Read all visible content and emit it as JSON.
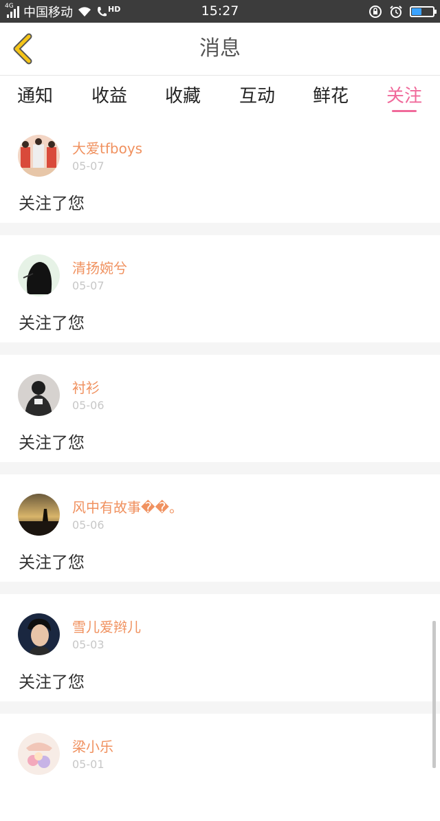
{
  "status_bar": {
    "network": "4G",
    "carrier": "中国移动",
    "hd": "HD",
    "time": "15:27",
    "battery_level": 0.45,
    "battery_color": "#3aa3ff"
  },
  "header": {
    "title": "消息",
    "back_icon": "chevron-left-icon",
    "back_color": "#f5c518"
  },
  "tabs": [
    {
      "label": "通知",
      "active": false
    },
    {
      "label": "收益",
      "active": false
    },
    {
      "label": "收藏",
      "active": false
    },
    {
      "label": "互动",
      "active": false
    },
    {
      "label": "鲜花",
      "active": false
    },
    {
      "label": "关注",
      "active": true
    }
  ],
  "accent_color": "#f0699a",
  "name_color": "#f0915f",
  "messages": [
    {
      "name": "大爱tfboys",
      "date": "05-07",
      "action": "关注了您"
    },
    {
      "name": "清扬婉兮",
      "date": "05-07",
      "action": "关注了您"
    },
    {
      "name": "衬衫",
      "date": "05-06",
      "action": "关注了您"
    },
    {
      "name": "风中有故事��。",
      "date": "05-06",
      "action": "关注了您"
    },
    {
      "name": "雪儿爱辫儿",
      "date": "05-03",
      "action": "关注了您"
    },
    {
      "name": "梁小乐",
      "date": "05-01",
      "action": ""
    }
  ]
}
